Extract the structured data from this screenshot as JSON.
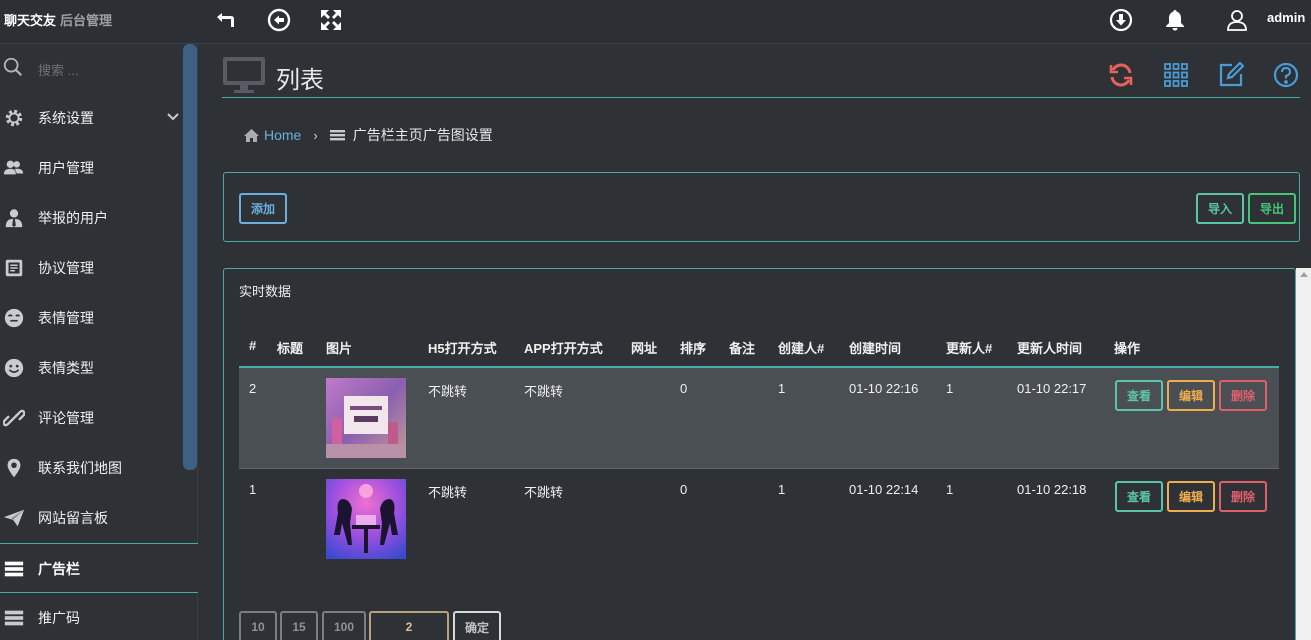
{
  "brand": {
    "name": "聊天交友",
    "sub": "后台管理"
  },
  "topbar": {
    "user": "admin"
  },
  "sidebar": {
    "search_placeholder": "搜索 ...",
    "items": [
      {
        "label": "系统设置",
        "icon": "gear-icon"
      },
      {
        "label": "用户管理",
        "icon": "users-icon"
      },
      {
        "label": "举报的用户",
        "icon": "user-tie-icon"
      },
      {
        "label": "协议管理",
        "icon": "document-icon"
      },
      {
        "label": "表情管理",
        "icon": "emoji-icon"
      },
      {
        "label": "表情类型",
        "icon": "emoji-type-icon"
      },
      {
        "label": "评论管理",
        "icon": "link-icon"
      },
      {
        "label": "联系我们地图",
        "icon": "map-marker-icon"
      },
      {
        "label": "网站留言板",
        "icon": "paper-plane-icon"
      },
      {
        "label": "广告栏",
        "icon": "list-icon"
      },
      {
        "label": "推广码",
        "icon": "list-icon"
      }
    ]
  },
  "main": {
    "title": "列表",
    "breadcrumb": {
      "home": "Home",
      "arrow": "›",
      "current": "广告栏主页广告图设置"
    },
    "buttons": {
      "add": "添加",
      "import": "导入",
      "export": "导出"
    },
    "panel_title": "实时数据",
    "table": {
      "headers": [
        "#",
        "标题",
        "图片",
        "H5打开方式",
        "APP打开方式",
        "网址",
        "排序",
        "备注",
        "创建人#",
        "创建时间",
        "更新人#",
        "更新人时间",
        "操作"
      ],
      "rows": [
        {
          "id": "2",
          "title": "",
          "h5": "不跳转",
          "app": "不跳转",
          "url": "",
          "sort": "0",
          "remark": "",
          "creator": "1",
          "created": "01-10 22:16",
          "updater": "1",
          "updated": "01-10 22:17"
        },
        {
          "id": "1",
          "title": "",
          "h5": "不跳转",
          "app": "不跳转",
          "url": "",
          "sort": "0",
          "remark": "",
          "creator": "1",
          "created": "01-10 22:14",
          "updater": "1",
          "updated": "01-10 22:18"
        }
      ],
      "actions": {
        "view": "查看",
        "edit": "编辑",
        "delete": "删除"
      }
    },
    "pager": {
      "sizes": [
        "10",
        "15",
        "100"
      ],
      "page": "2",
      "confirm": "确定"
    }
  },
  "colors": {
    "accent": "#46ada8",
    "link": "#6ab0de",
    "view": "#5cc4a8",
    "edit": "#f0ad4e",
    "delete": "#e0606a",
    "refresh": "#e8625a"
  }
}
